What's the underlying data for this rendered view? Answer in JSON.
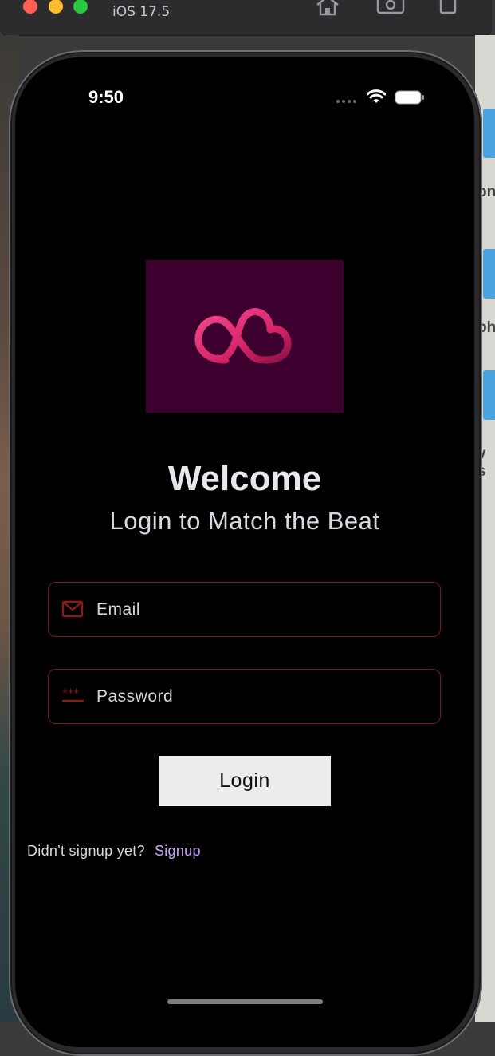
{
  "simulator": {
    "title": "iOS 17.5",
    "toolbar_icons": [
      "home-icon",
      "screenshot-icon",
      "rotate-icon"
    ]
  },
  "desktop_fragments": [
    "on",
    "oh",
    "v s"
  ],
  "status_bar": {
    "time": "9:50",
    "icons": [
      "signal-dots-icon",
      "wifi-icon",
      "battery-icon"
    ]
  },
  "app": {
    "logo_icon": "cloud-heart-logo-icon",
    "title": "Welcome",
    "subtitle": "Login to Match the Beat",
    "email": {
      "placeholder": "Email",
      "value": "",
      "icon": "mail-icon"
    },
    "password": {
      "placeholder": "Password",
      "value": "",
      "icon": "password-dots-icon"
    },
    "login_label": "Login",
    "signup_prompt": "Didn't signup yet?",
    "signup_link": "Signup"
  },
  "colors": {
    "logo_bg": "#3d0130",
    "logo_accent": "#e8337a",
    "field_border": "#7a1814",
    "link": "#c6a7f2",
    "button_bg": "#ececec"
  }
}
